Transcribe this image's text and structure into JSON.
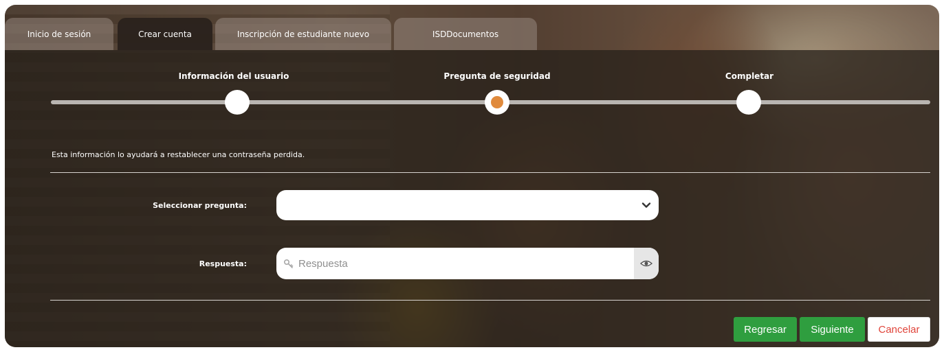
{
  "tabs": [
    {
      "label": "Inicio de sesión",
      "active": false
    },
    {
      "label": "Crear cuenta",
      "active": true
    },
    {
      "label": "Inscripción de estudiante nuevo",
      "active": false
    },
    {
      "label": "ISDDocumentos",
      "active": false
    }
  ],
  "steps": [
    {
      "label": "Información del usuario",
      "state": "done"
    },
    {
      "label": "Pregunta de seguridad",
      "state": "current"
    },
    {
      "label": "Completar",
      "state": "pending"
    }
  ],
  "info_text": "Esta información lo ayudará a restablecer una contraseña perdida.",
  "form": {
    "question_label": "Seleccionar pregunta:",
    "question_value": "",
    "answer_label": "Respuesta:",
    "answer_placeholder": "Respuesta",
    "answer_value": ""
  },
  "buttons": {
    "back": "Regresar",
    "next": "Siguiente",
    "cancel": "Cancelar"
  },
  "colors": {
    "accent_step": "#e08a3c",
    "primary_button": "#2f9e3f",
    "cancel_text": "#e0443a"
  },
  "icons": {
    "select": "chevron-down-icon",
    "answer": "key-icon",
    "reveal": "eye-icon"
  }
}
